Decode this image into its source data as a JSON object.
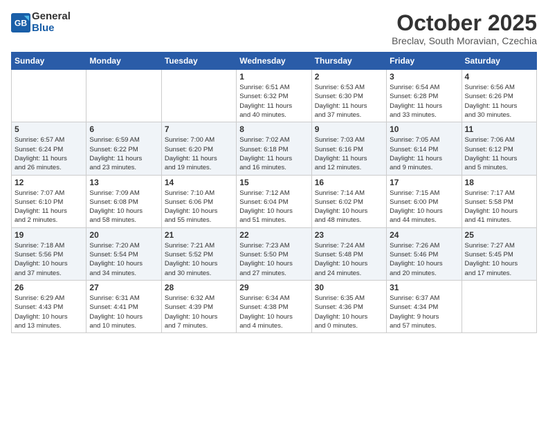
{
  "header": {
    "logo_line1": "General",
    "logo_line2": "Blue",
    "month": "October 2025",
    "location": "Breclav, South Moravian, Czechia"
  },
  "weekdays": [
    "Sunday",
    "Monday",
    "Tuesday",
    "Wednesday",
    "Thursday",
    "Friday",
    "Saturday"
  ],
  "rows": [
    {
      "alt": false,
      "cells": [
        {
          "day": "",
          "info": ""
        },
        {
          "day": "",
          "info": ""
        },
        {
          "day": "",
          "info": ""
        },
        {
          "day": "1",
          "info": "Sunrise: 6:51 AM\nSunset: 6:32 PM\nDaylight: 11 hours\nand 40 minutes."
        },
        {
          "day": "2",
          "info": "Sunrise: 6:53 AM\nSunset: 6:30 PM\nDaylight: 11 hours\nand 37 minutes."
        },
        {
          "day": "3",
          "info": "Sunrise: 6:54 AM\nSunset: 6:28 PM\nDaylight: 11 hours\nand 33 minutes."
        },
        {
          "day": "4",
          "info": "Sunrise: 6:56 AM\nSunset: 6:26 PM\nDaylight: 11 hours\nand 30 minutes."
        }
      ]
    },
    {
      "alt": true,
      "cells": [
        {
          "day": "5",
          "info": "Sunrise: 6:57 AM\nSunset: 6:24 PM\nDaylight: 11 hours\nand 26 minutes."
        },
        {
          "day": "6",
          "info": "Sunrise: 6:59 AM\nSunset: 6:22 PM\nDaylight: 11 hours\nand 23 minutes."
        },
        {
          "day": "7",
          "info": "Sunrise: 7:00 AM\nSunset: 6:20 PM\nDaylight: 11 hours\nand 19 minutes."
        },
        {
          "day": "8",
          "info": "Sunrise: 7:02 AM\nSunset: 6:18 PM\nDaylight: 11 hours\nand 16 minutes."
        },
        {
          "day": "9",
          "info": "Sunrise: 7:03 AM\nSunset: 6:16 PM\nDaylight: 11 hours\nand 12 minutes."
        },
        {
          "day": "10",
          "info": "Sunrise: 7:05 AM\nSunset: 6:14 PM\nDaylight: 11 hours\nand 9 minutes."
        },
        {
          "day": "11",
          "info": "Sunrise: 7:06 AM\nSunset: 6:12 PM\nDaylight: 11 hours\nand 5 minutes."
        }
      ]
    },
    {
      "alt": false,
      "cells": [
        {
          "day": "12",
          "info": "Sunrise: 7:07 AM\nSunset: 6:10 PM\nDaylight: 11 hours\nand 2 minutes."
        },
        {
          "day": "13",
          "info": "Sunrise: 7:09 AM\nSunset: 6:08 PM\nDaylight: 10 hours\nand 58 minutes."
        },
        {
          "day": "14",
          "info": "Sunrise: 7:10 AM\nSunset: 6:06 PM\nDaylight: 10 hours\nand 55 minutes."
        },
        {
          "day": "15",
          "info": "Sunrise: 7:12 AM\nSunset: 6:04 PM\nDaylight: 10 hours\nand 51 minutes."
        },
        {
          "day": "16",
          "info": "Sunrise: 7:14 AM\nSunset: 6:02 PM\nDaylight: 10 hours\nand 48 minutes."
        },
        {
          "day": "17",
          "info": "Sunrise: 7:15 AM\nSunset: 6:00 PM\nDaylight: 10 hours\nand 44 minutes."
        },
        {
          "day": "18",
          "info": "Sunrise: 7:17 AM\nSunset: 5:58 PM\nDaylight: 10 hours\nand 41 minutes."
        }
      ]
    },
    {
      "alt": true,
      "cells": [
        {
          "day": "19",
          "info": "Sunrise: 7:18 AM\nSunset: 5:56 PM\nDaylight: 10 hours\nand 37 minutes."
        },
        {
          "day": "20",
          "info": "Sunrise: 7:20 AM\nSunset: 5:54 PM\nDaylight: 10 hours\nand 34 minutes."
        },
        {
          "day": "21",
          "info": "Sunrise: 7:21 AM\nSunset: 5:52 PM\nDaylight: 10 hours\nand 30 minutes."
        },
        {
          "day": "22",
          "info": "Sunrise: 7:23 AM\nSunset: 5:50 PM\nDaylight: 10 hours\nand 27 minutes."
        },
        {
          "day": "23",
          "info": "Sunrise: 7:24 AM\nSunset: 5:48 PM\nDaylight: 10 hours\nand 24 minutes."
        },
        {
          "day": "24",
          "info": "Sunrise: 7:26 AM\nSunset: 5:46 PM\nDaylight: 10 hours\nand 20 minutes."
        },
        {
          "day": "25",
          "info": "Sunrise: 7:27 AM\nSunset: 5:45 PM\nDaylight: 10 hours\nand 17 minutes."
        }
      ]
    },
    {
      "alt": false,
      "cells": [
        {
          "day": "26",
          "info": "Sunrise: 6:29 AM\nSunset: 4:43 PM\nDaylight: 10 hours\nand 13 minutes."
        },
        {
          "day": "27",
          "info": "Sunrise: 6:31 AM\nSunset: 4:41 PM\nDaylight: 10 hours\nand 10 minutes."
        },
        {
          "day": "28",
          "info": "Sunrise: 6:32 AM\nSunset: 4:39 PM\nDaylight: 10 hours\nand 7 minutes."
        },
        {
          "day": "29",
          "info": "Sunrise: 6:34 AM\nSunset: 4:38 PM\nDaylight: 10 hours\nand 4 minutes."
        },
        {
          "day": "30",
          "info": "Sunrise: 6:35 AM\nSunset: 4:36 PM\nDaylight: 10 hours\nand 0 minutes."
        },
        {
          "day": "31",
          "info": "Sunrise: 6:37 AM\nSunset: 4:34 PM\nDaylight: 9 hours\nand 57 minutes."
        },
        {
          "day": "",
          "info": ""
        }
      ]
    }
  ]
}
